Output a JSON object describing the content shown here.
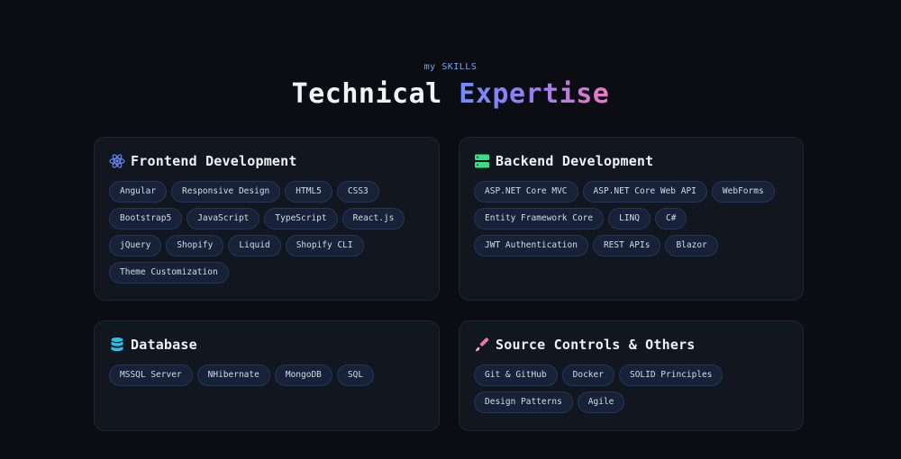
{
  "header": {
    "eyebrow": "my SKILLS",
    "title_part1": "Technical",
    "title_part2": "Expertise"
  },
  "accent_colors": {
    "eyebrow": "#6ea8ff",
    "gradient_start": "#6f8cff",
    "gradient_end": "#ec7bc0",
    "frontend_icon": "#6c8cff",
    "backend_icon": "#3ddc84",
    "database_icon": "#22c3ee",
    "others_icon": "#f472b6"
  },
  "cards": [
    {
      "title": "Frontend Development",
      "icon": "react-atom-icon",
      "skills": [
        "Angular",
        "Responsive Design",
        "HTML5",
        "CSS3",
        "Bootstrap5",
        "JavaScript",
        "TypeScript",
        "React.js",
        "jQuery",
        "Shopify",
        "Liquid",
        "Shopify CLI",
        "Theme Customization"
      ]
    },
    {
      "title": "Backend Development",
      "icon": "server-icon",
      "skills": [
        "ASP.NET Core MVC",
        "ASP.NET Core Web API",
        "WebForms",
        "Entity Framework Core",
        "LINQ",
        "C#",
        "JWT Authentication",
        "REST APIs",
        "Blazor"
      ]
    },
    {
      "title": "Database",
      "icon": "database-icon",
      "skills": [
        "MSSQL Server",
        "NHibernate",
        "MongoDB",
        "SQL"
      ]
    },
    {
      "title": "Source Controls & Others",
      "icon": "brush-icon",
      "skills": [
        "Git & GitHub",
        "Docker",
        "SOLID Principles",
        "Design Patterns",
        "Agile"
      ]
    }
  ]
}
